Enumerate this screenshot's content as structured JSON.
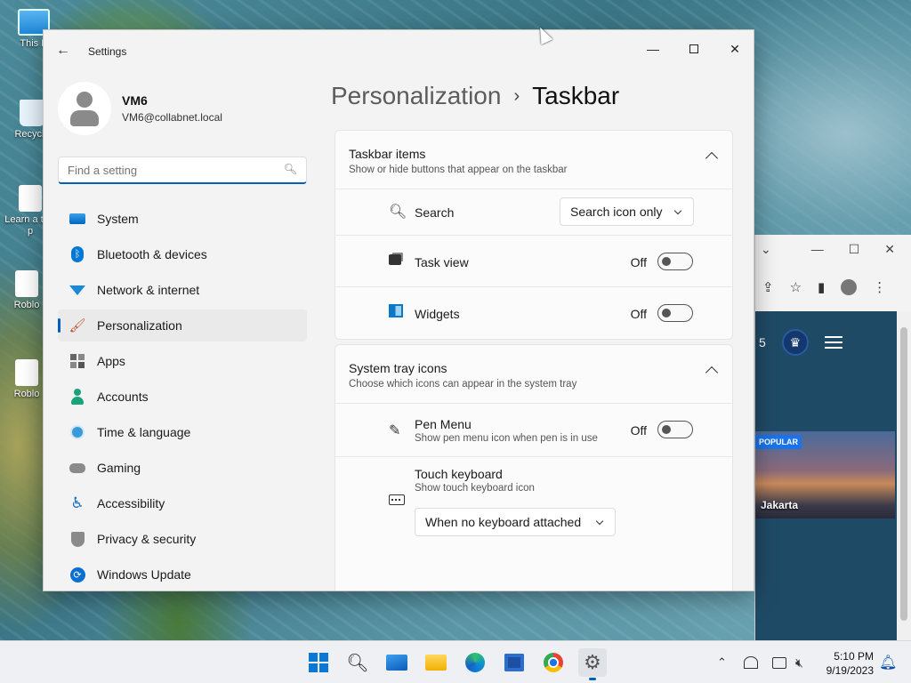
{
  "desktop": {
    "icons": [
      {
        "label": "This P"
      },
      {
        "label": "Recycle"
      },
      {
        "label": "Learn a this p"
      },
      {
        "label": "Roblo"
      },
      {
        "label": "Roblo"
      }
    ]
  },
  "browser": {
    "score_fragment": "5",
    "popular_badge": "POPULAR",
    "card_city": "Jakarta"
  },
  "settings": {
    "window_title": "Settings",
    "profile": {
      "name": "VM6",
      "email": "VM6@collabnet.local"
    },
    "search": {
      "placeholder": "Find a setting"
    },
    "nav": [
      {
        "label": "System",
        "icon": "monitor-icon"
      },
      {
        "label": "Bluetooth & devices",
        "icon": "bluetooth-icon"
      },
      {
        "label": "Network & internet",
        "icon": "wifi-icon"
      },
      {
        "label": "Personalization",
        "icon": "brush-icon",
        "active": true
      },
      {
        "label": "Apps",
        "icon": "apps-icon"
      },
      {
        "label": "Accounts",
        "icon": "person-icon"
      },
      {
        "label": "Time & language",
        "icon": "clock-globe-icon"
      },
      {
        "label": "Gaming",
        "icon": "gamepad-icon"
      },
      {
        "label": "Accessibility",
        "icon": "accessibility-icon"
      },
      {
        "label": "Privacy & security",
        "icon": "shield-icon"
      },
      {
        "label": "Windows Update",
        "icon": "update-icon"
      }
    ],
    "breadcrumb": {
      "parent": "Personalization",
      "separator": "›",
      "current": "Taskbar"
    },
    "taskbar_items": {
      "title": "Taskbar items",
      "subtitle": "Show or hide buttons that appear on the taskbar",
      "search": {
        "label": "Search",
        "value": "Search icon only"
      },
      "task_view": {
        "label": "Task view",
        "state": "Off"
      },
      "widgets": {
        "label": "Widgets",
        "state": "Off"
      }
    },
    "system_tray": {
      "title": "System tray icons",
      "subtitle": "Choose which icons can appear in the system tray",
      "pen_menu": {
        "label": "Pen Menu",
        "sub": "Show pen menu icon when pen is in use",
        "state": "Off"
      },
      "touch_keyboard": {
        "label": "Touch keyboard",
        "sub": "Show touch keyboard icon",
        "value": "When no keyboard attached"
      }
    }
  },
  "taskbar": {
    "time": "5:10 PM",
    "date": "9/19/2023"
  },
  "colors": {
    "accent": "#005fb8",
    "window_bg": "#f3f3f3"
  }
}
